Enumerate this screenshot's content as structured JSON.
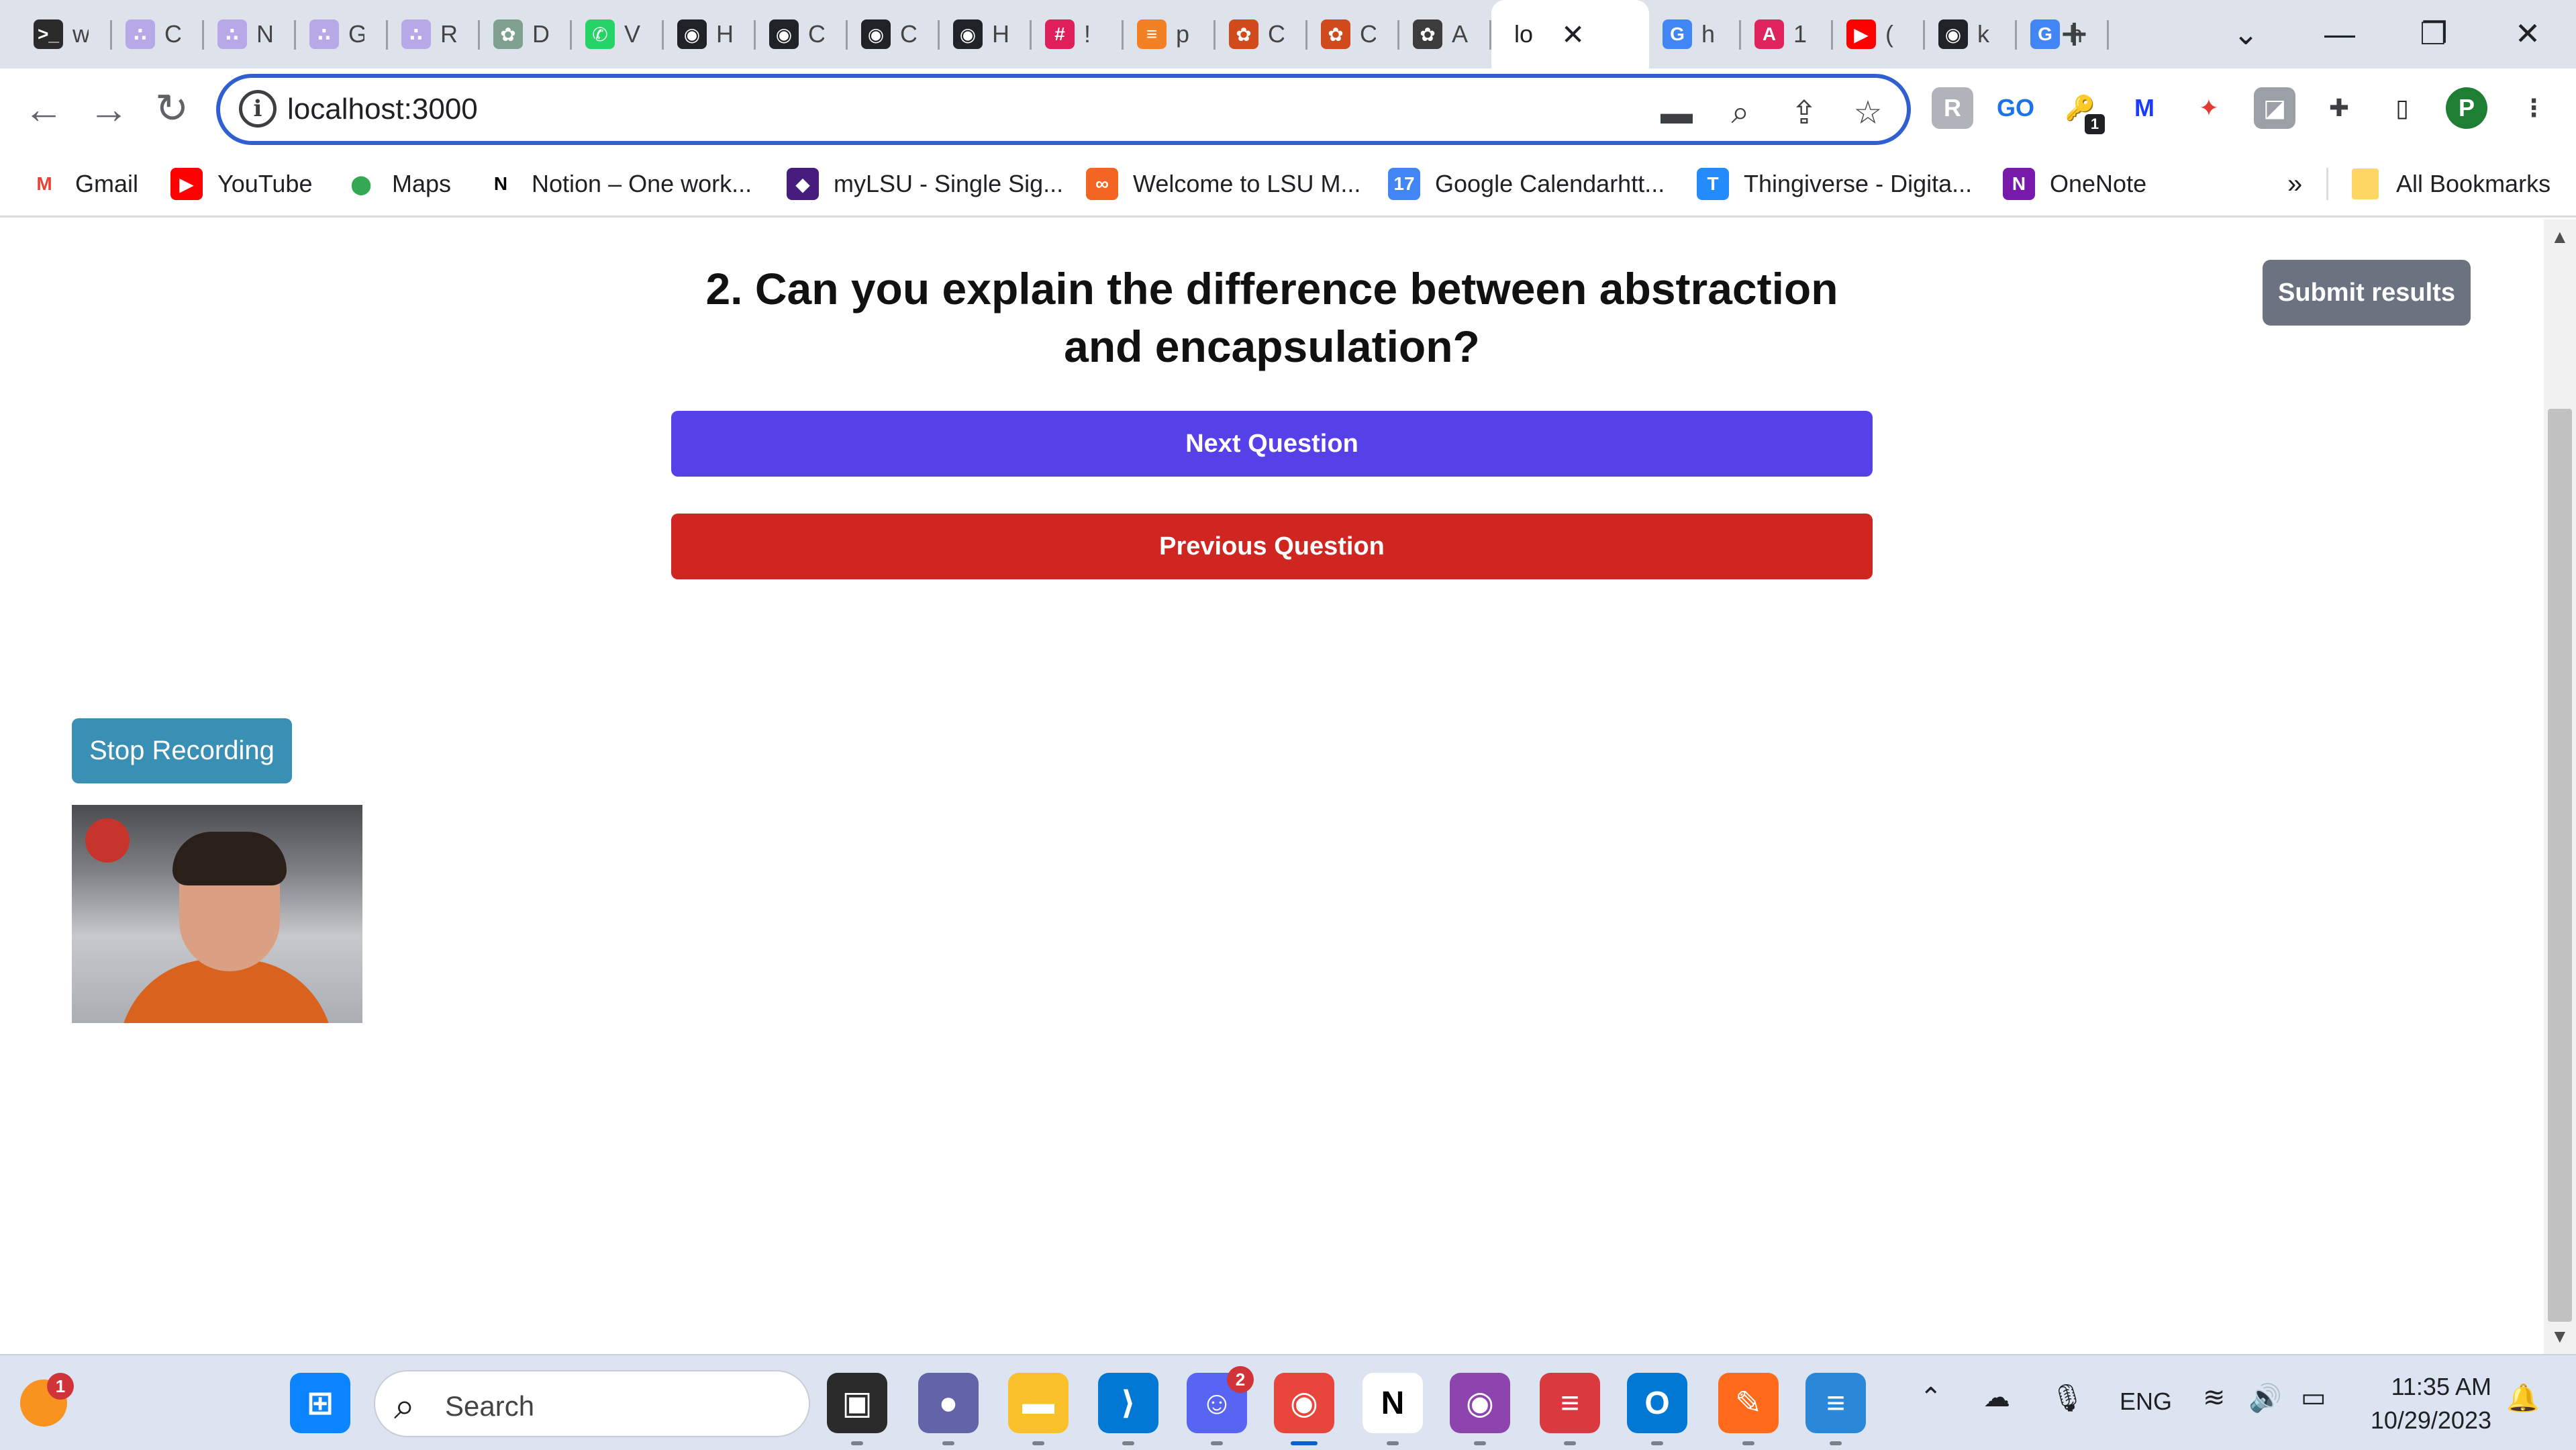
{
  "browser": {
    "tabs": [
      {
        "glyph": ">_",
        "bg": "#2b2b2b",
        "title": "w"
      },
      {
        "glyph": "∴",
        "bg": "#b7a8e8",
        "title": "C"
      },
      {
        "glyph": "∴",
        "bg": "#b7a8e8",
        "title": "N"
      },
      {
        "glyph": "∴",
        "bg": "#b7a8e8",
        "title": "G"
      },
      {
        "glyph": "∴",
        "bg": "#b7a8e8",
        "title": "R"
      },
      {
        "glyph": "✿",
        "bg": "#7fa08f",
        "title": "D"
      },
      {
        "glyph": "✆",
        "bg": "#25d366",
        "title": "V"
      },
      {
        "glyph": "◉",
        "bg": "#1f2328",
        "title": "H"
      },
      {
        "glyph": "◉",
        "bg": "#1f2328",
        "title": "C"
      },
      {
        "glyph": "◉",
        "bg": "#1f2328",
        "title": "C"
      },
      {
        "glyph": "◉",
        "bg": "#1f2328",
        "title": "H"
      },
      {
        "glyph": "#",
        "bg": "#e01e5a",
        "title": "!"
      },
      {
        "glyph": "≡",
        "bg": "#f48024",
        "title": "p"
      },
      {
        "glyph": "✿",
        "bg": "#d04a1c",
        "title": "C"
      },
      {
        "glyph": "✿",
        "bg": "#d04a1c",
        "title": "C"
      },
      {
        "glyph": "✿",
        "bg": "#3c3c3c",
        "title": "A"
      },
      {
        "glyph": "",
        "bg": "#ffffff",
        "title": "lo",
        "active": true
      },
      {
        "glyph": "G",
        "bg": "#4285f4",
        "title": "h"
      },
      {
        "glyph": "A",
        "bg": "#e0245e",
        "title": "1"
      },
      {
        "glyph": "▶",
        "bg": "#ff0000",
        "title": "("
      },
      {
        "glyph": "◉",
        "bg": "#1f2328",
        "title": "k"
      },
      {
        "glyph": "G",
        "bg": "#4285f4",
        "title": "h"
      }
    ],
    "tab_close": "✕",
    "new_tab": "+",
    "window_controls": {
      "dropdown": "⌄",
      "minimize": "—",
      "restore": "❐",
      "close": "✕"
    },
    "nav": {
      "back": "←",
      "forward": "→",
      "reload": "↻"
    },
    "url": "localhost:3000",
    "omnibox_info": "i",
    "omnibox_icons": {
      "camera": "▬",
      "zoom": "⌕",
      "share": "⇪",
      "star": "☆"
    },
    "extensions": [
      {
        "label": "R",
        "bg": "#b0b4ba"
      },
      {
        "label": "GO",
        "bg": "#ffffff",
        "color": "#1a73e8"
      },
      {
        "label": "🔑",
        "bg": "#ffffff",
        "color": "#1a73e8"
      },
      {
        "label": "M",
        "bg": "#ffffff",
        "color": "#1a3cff"
      },
      {
        "label": "✦",
        "bg": "#ffffff",
        "color": "#e53935"
      },
      {
        "label": "◪",
        "bg": "#9aa0a6"
      },
      {
        "label": "✚",
        "bg": "#ffffff",
        "color": "#3c4043"
      },
      {
        "label": "▯",
        "bg": "#ffffff",
        "color": "#202124"
      },
      {
        "label": "P",
        "bg": "#1e7e34",
        "round": true
      },
      {
        "label": "⋮",
        "bg": "#ffffff",
        "color": "#3c4043"
      }
    ],
    "ext_badge": "1",
    "bookmarks": [
      {
        "label": "Gmail",
        "icon": "M",
        "bg": "#ffffff",
        "color": "#ea4335"
      },
      {
        "label": "YouTube",
        "icon": "▶",
        "bg": "#ff0000"
      },
      {
        "label": "Maps",
        "icon": "⬤",
        "bg": "#ffffff",
        "color": "#34a853"
      },
      {
        "label": "Notion – One work...",
        "icon": "N",
        "bg": "#ffffff",
        "color": "#000000"
      },
      {
        "label": "myLSU - Single Sig...",
        "icon": "◆",
        "bg": "#461d7c"
      },
      {
        "label": "Welcome to LSU M...",
        "icon": "∞",
        "bg": "#f26522"
      },
      {
        "label": "Google Calendarhtt...",
        "icon": "17",
        "bg": "#4285f4"
      },
      {
        "label": "Thingiverse - Digita...",
        "icon": "T",
        "bg": "#248bfb"
      },
      {
        "label": "OneNote",
        "icon": "N",
        "bg": "#7719aa"
      }
    ],
    "bookmarks_more": "»",
    "all_bookmarks": "All Bookmarks"
  },
  "page": {
    "question": "2. Can you explain the difference between abstraction and encapsulation?",
    "next_label": "Next Question",
    "prev_label": "Previous Question",
    "submit_label": "Submit results",
    "stop_recording_label": "Stop Recording"
  },
  "taskbar": {
    "weather_badge": "1",
    "search_placeholder": "Search",
    "apps": [
      {
        "name": "windows-start",
        "glyph": "⊞",
        "bg": "#0a84ff"
      },
      {
        "name": "task-view",
        "glyph": "▣",
        "bg": "#2b2b2b"
      },
      {
        "name": "zoom",
        "glyph": "●",
        "bg": "#6264a7"
      },
      {
        "name": "file-explorer",
        "glyph": "▬",
        "bg": "#f8c12c"
      },
      {
        "name": "vscode",
        "glyph": "⟩",
        "bg": "#0078d4"
      },
      {
        "name": "discord",
        "glyph": "☺",
        "bg": "#5865f2",
        "badge": "2"
      },
      {
        "name": "chrome",
        "glyph": "◉",
        "bg": "#e8453c"
      },
      {
        "name": "notion",
        "glyph": "N",
        "bg": "#ffffff",
        "color": "#000000"
      },
      {
        "name": "github-desktop",
        "glyph": "◉",
        "bg": "#8e44ad"
      },
      {
        "name": "expressvpn",
        "glyph": "≡",
        "bg": "#da3940"
      },
      {
        "name": "outlook",
        "glyph": "O",
        "bg": "#0078d4"
      },
      {
        "name": "pen-app",
        "glyph": "✎",
        "bg": "#ff6b1a"
      },
      {
        "name": "notepad",
        "glyph": "≡",
        "bg": "#2b88d8"
      }
    ],
    "tray_chevron": "⌃",
    "tray_cloud": "☁",
    "tray_mic": "🎙",
    "language": "ENG",
    "tray_wifi": "≋",
    "tray_volume": "🔊",
    "tray_battery": "▭",
    "time": "11:35 AM",
    "date": "10/29/2023",
    "notification": "🔔"
  }
}
